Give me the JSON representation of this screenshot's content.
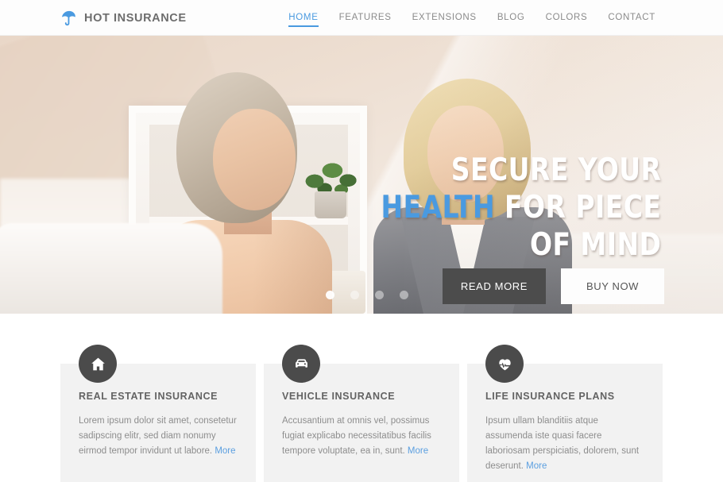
{
  "header": {
    "logo_icon": "umbrella-icon",
    "brand": "HOT INSURANCE",
    "brand_color": "#4a9ae0",
    "nav": [
      {
        "label": "HOME",
        "active": true
      },
      {
        "label": "FEATURES",
        "active": false
      },
      {
        "label": "EXTENSIONS",
        "active": false
      },
      {
        "label": "BLOG",
        "active": false
      },
      {
        "label": "COLORS",
        "active": false
      },
      {
        "label": "CONTACT",
        "active": false
      }
    ]
  },
  "hero": {
    "line1": "SECURE YOUR",
    "line2_accent": "HEALTH",
    "line2_rest": " FOR PIECE",
    "line3": "OF MIND",
    "accent_color": "#4a9ae0",
    "primary_button": "READ MORE",
    "secondary_button": "BUY NOW",
    "primary_button_color": "#4c4c4c",
    "slides": 4,
    "active_slide": 1
  },
  "services": [
    {
      "icon": "home-icon",
      "title": "REAL ESTATE INSURANCE",
      "text": "Lorem ipsum dolor sit amet, consetetur sadipscing elitr, sed diam nonumy eirmod tempor invidunt ut labore. ",
      "more": "More"
    },
    {
      "icon": "car-icon",
      "title": "VEHICLE INSURANCE",
      "text": "Accusantium at omnis vel, possimus fugiat explicabo necessitatibus facilis tempore voluptate, ea in, sunt. ",
      "more": "More"
    },
    {
      "icon": "heartbeat-icon",
      "title": "LIFE INSURANCE PLANS",
      "text": "Ipsum ullam blanditiis atque assumenda iste quasi facere laboriosam perspiciatis, dolorem, sunt deserunt. ",
      "more": "More"
    }
  ]
}
